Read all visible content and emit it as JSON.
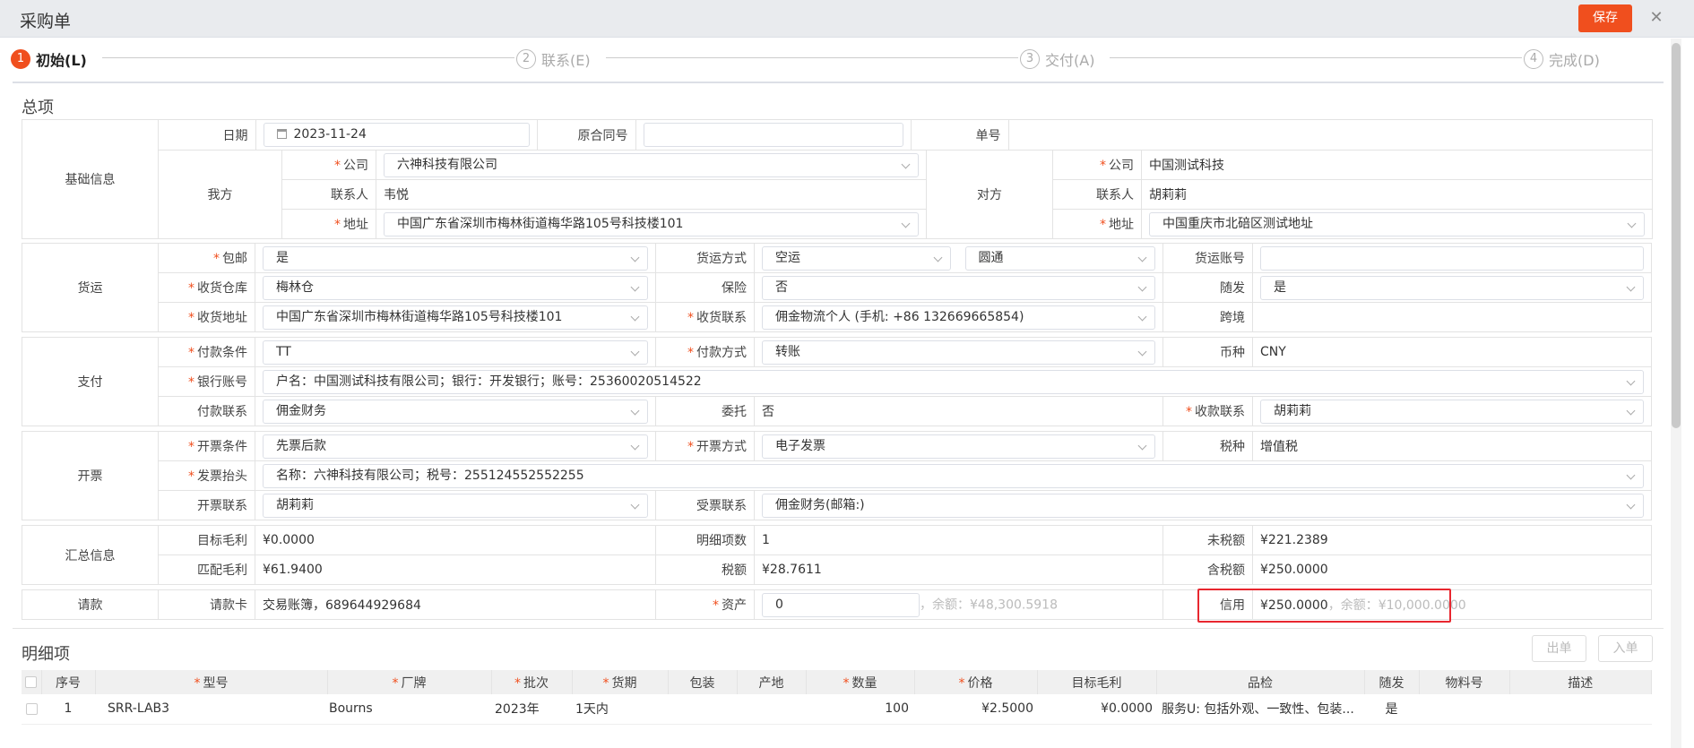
{
  "window": {
    "title": "采购单",
    "save_label": "保存",
    "close_glyph": "✕"
  },
  "steps": [
    {
      "num": "1",
      "label": "初始(L)",
      "active": true
    },
    {
      "num": "2",
      "label": "联系(E)"
    },
    {
      "num": "3",
      "label": "交付(A)"
    },
    {
      "num": "4",
      "label": "完成(D)"
    }
  ],
  "summary": {
    "title": "总项",
    "basic": {
      "group": "基础信息",
      "date_label": "日期",
      "date_value": "2023-11-24",
      "contract_label": "原合同号",
      "contract_value": "",
      "number_label": "单号",
      "number_value": "",
      "ours": {
        "label": "我方",
        "company_label": "公司",
        "company": "六神科技有限公司",
        "contact_label": "联系人",
        "contact": "韦悦",
        "address_label": "地址",
        "address": "中国广东省深圳市梅林街道梅华路105号科技楼101"
      },
      "theirs": {
        "label": "对方",
        "company_label": "公司",
        "company": "中国测试科技",
        "contact_label": "联系人",
        "contact": "胡莉莉",
        "address_label": "地址",
        "address": "中国重庆市北碚区测试地址"
      }
    },
    "shipping": {
      "group": "货运",
      "free_label": "包邮",
      "free": "是",
      "method_label": "货运方式",
      "method": "空运",
      "carrier": "圆通",
      "account_label": "货运账号",
      "account": "",
      "warehouse_label": "收货仓库",
      "warehouse": "梅林仓",
      "insurance_label": "保险",
      "insurance": "否",
      "follow_label": "随发",
      "follow": "是",
      "address_label": "收货地址",
      "address": "中国广东省深圳市梅林街道梅华路105号科技楼101",
      "contact_label": "收货联系",
      "contact": "佣金物流个人 (手机: +86 132669665854)",
      "cross_label": "跨境",
      "cross": ""
    },
    "payment": {
      "group": "支付",
      "terms_label": "付款条件",
      "terms": "TT",
      "method_label": "付款方式",
      "method": "转账",
      "currency_label": "币种",
      "currency": "CNY",
      "bank_label": "银行账号",
      "bank": "户名：中国测试科技有限公司；银行：开发银行；账号：25360020514522",
      "contact_label": "付款联系",
      "contact": "佣金财务",
      "entrust_label": "委托",
      "entrust": "否",
      "receive_label": "收款联系",
      "receive": "胡莉莉"
    },
    "invoice": {
      "group": "开票",
      "terms_label": "开票条件",
      "terms": "先票后款",
      "method_label": "开票方式",
      "method": "电子发票",
      "tax_label": "税种",
      "tax": "增值税",
      "header_label": "发票抬头",
      "header": "名称：六神科技有限公司；税号：255124552552255",
      "contact_label": "开票联系",
      "contact": "胡莉莉",
      "receiver_label": "受票联系",
      "receiver": "佣金财务(邮箱:)"
    },
    "totals": {
      "group": "汇总信息",
      "target_label": "目标毛利",
      "target": "¥0.0000",
      "items_label": "明细项数",
      "items": "1",
      "pretax_label": "未税额",
      "pretax": "¥221.2389",
      "match_label": "匹配毛利",
      "match": "¥61.9400",
      "taxamt_label": "税额",
      "taxamt": "¥28.7611",
      "withtax_label": "含税额",
      "withtax": "¥250.0000"
    },
    "request": {
      "group": "请款",
      "card_label": "请款卡",
      "card": "交易账簿，689644929684",
      "asset_label": "资产",
      "asset": "0",
      "asset_balance": "，余额：¥48,300.5918",
      "credit_label": "信用",
      "credit": "¥250.0000",
      "credit_balance": "，余额：¥10,000.0000"
    }
  },
  "detail": {
    "title": "明细项",
    "out_label": "出单",
    "in_label": "入单",
    "columns": [
      {
        "label": "序号"
      },
      {
        "label": "型号",
        "req": true
      },
      {
        "label": "厂牌",
        "req": true
      },
      {
        "label": "批次",
        "req": true
      },
      {
        "label": "货期",
        "req": true
      },
      {
        "label": "包装"
      },
      {
        "label": "产地"
      },
      {
        "label": "数量",
        "req": true
      },
      {
        "label": "价格",
        "req": true
      },
      {
        "label": "目标毛利"
      },
      {
        "label": "品检"
      },
      {
        "label": "随发"
      },
      {
        "label": "物料号"
      },
      {
        "label": "描述"
      }
    ],
    "rows": [
      {
        "no": "1",
        "model": "SRR-LAB3",
        "brand": "Bourns",
        "batch": "2023年",
        "lead": "1天内",
        "pack": "",
        "origin": "",
        "qty": "100",
        "price": "¥2.5000",
        "margin": "¥0.0000",
        "qc": "服务U: 包括外观、一致性、包装...",
        "follow": "是",
        "material": "",
        "desc": ""
      }
    ]
  }
}
